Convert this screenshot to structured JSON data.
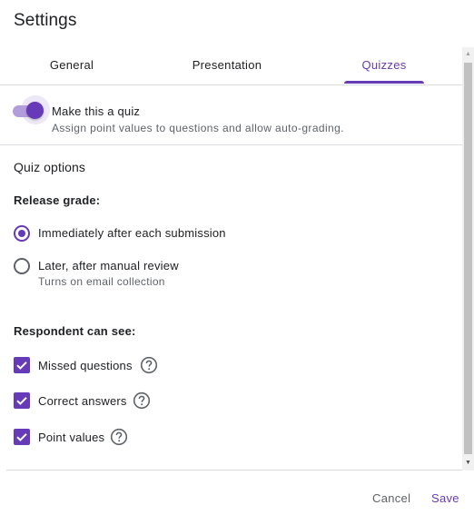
{
  "dialog": {
    "title": "Settings"
  },
  "tabs": [
    {
      "label": "General",
      "active": false
    },
    {
      "label": "Presentation",
      "active": false
    },
    {
      "label": "Quizzes",
      "active": true
    }
  ],
  "quiz_toggle": {
    "label": "Make this a quiz",
    "description": "Assign point values to questions and allow auto-grading.",
    "enabled": true
  },
  "quiz_options": {
    "title": "Quiz options",
    "release_grade": {
      "label": "Release grade:",
      "options": [
        {
          "label": "Immediately after each submission",
          "selected": true
        },
        {
          "label": "Later, after manual review",
          "sublabel": "Turns on email collection",
          "selected": false
        }
      ]
    },
    "respondent_can_see": {
      "label": "Respondent can see:",
      "items": [
        {
          "label": "Missed questions",
          "checked": true,
          "icon": "help-icon"
        },
        {
          "label": "Correct answers",
          "checked": true,
          "icon": "help-icon"
        },
        {
          "label": "Point values",
          "checked": true,
          "icon": "help-icon"
        }
      ]
    }
  },
  "footer": {
    "cancel_label": "Cancel",
    "save_label": "Save"
  },
  "colors": {
    "accent": "#673ab7",
    "accent_light": "#b39ddb",
    "text_primary": "#202124",
    "text_secondary": "#5f6368",
    "divider": "#dadce0"
  }
}
